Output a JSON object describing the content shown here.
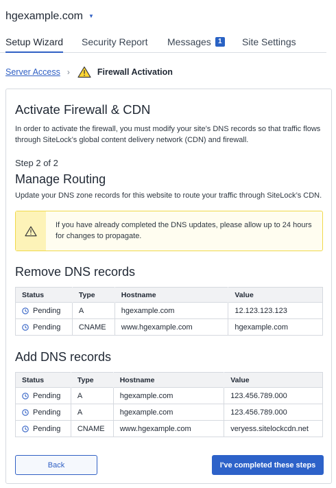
{
  "site": {
    "name": "hgexample.com"
  },
  "tabs": [
    {
      "label": "Setup Wizard"
    },
    {
      "label": "Security Report"
    },
    {
      "label": "Messages",
      "badge": "1"
    },
    {
      "label": "Site Settings"
    }
  ],
  "breadcrumb": {
    "parent": "Server Access",
    "separator": "›",
    "current": "Firewall Activation"
  },
  "card": {
    "title": "Activate Firewall & CDN",
    "intro": "In order to activate the firewall, you must modify your site’s DNS records so that traffic flows through SiteLock’s global content delivery network (CDN) and firewall.",
    "step": "Step 2 of 2",
    "subtitle": "Manage Routing",
    "description": "Update your DNS zone records for this website to route your traffic through SiteLock’s CDN.",
    "alert": "If you have already completed the DNS updates, please allow up to 24 hours for changes to propagate."
  },
  "remove": {
    "title": "Remove DNS records",
    "headers": [
      "Status",
      "Type",
      "Hostname",
      "Value"
    ],
    "rows": [
      {
        "status": "Pending",
        "type": "A",
        "hostname": "hgexample.com",
        "value": "12.123.123.123"
      },
      {
        "status": "Pending",
        "type": "CNAME",
        "hostname": "www.hgexample.com",
        "value": "hgexample.com"
      }
    ]
  },
  "add": {
    "title": "Add DNS records",
    "headers": [
      "Status",
      "Type",
      "Hostname",
      "Value"
    ],
    "rows": [
      {
        "status": "Pending",
        "type": "A",
        "hostname": "hgexample.com",
        "value": "123.456.789.000"
      },
      {
        "status": "Pending",
        "type": "A",
        "hostname": "hgexample.com",
        "value": "123.456.789.000"
      },
      {
        "status": "Pending",
        "type": "CNAME",
        "hostname": "www.hgexample.com",
        "value": "veryess.sitelockcdn.net"
      }
    ]
  },
  "buttons": {
    "back": "Back",
    "done": "I've completed these steps"
  },
  "colors": {
    "accent": "#2d62c9",
    "warning": "#f0d84a",
    "warning_bg": "#fdf3b8"
  },
  "icons": {
    "warning": "warning-triangle-icon",
    "status": "clock-icon",
    "site_menu": "caret-down-icon"
  }
}
